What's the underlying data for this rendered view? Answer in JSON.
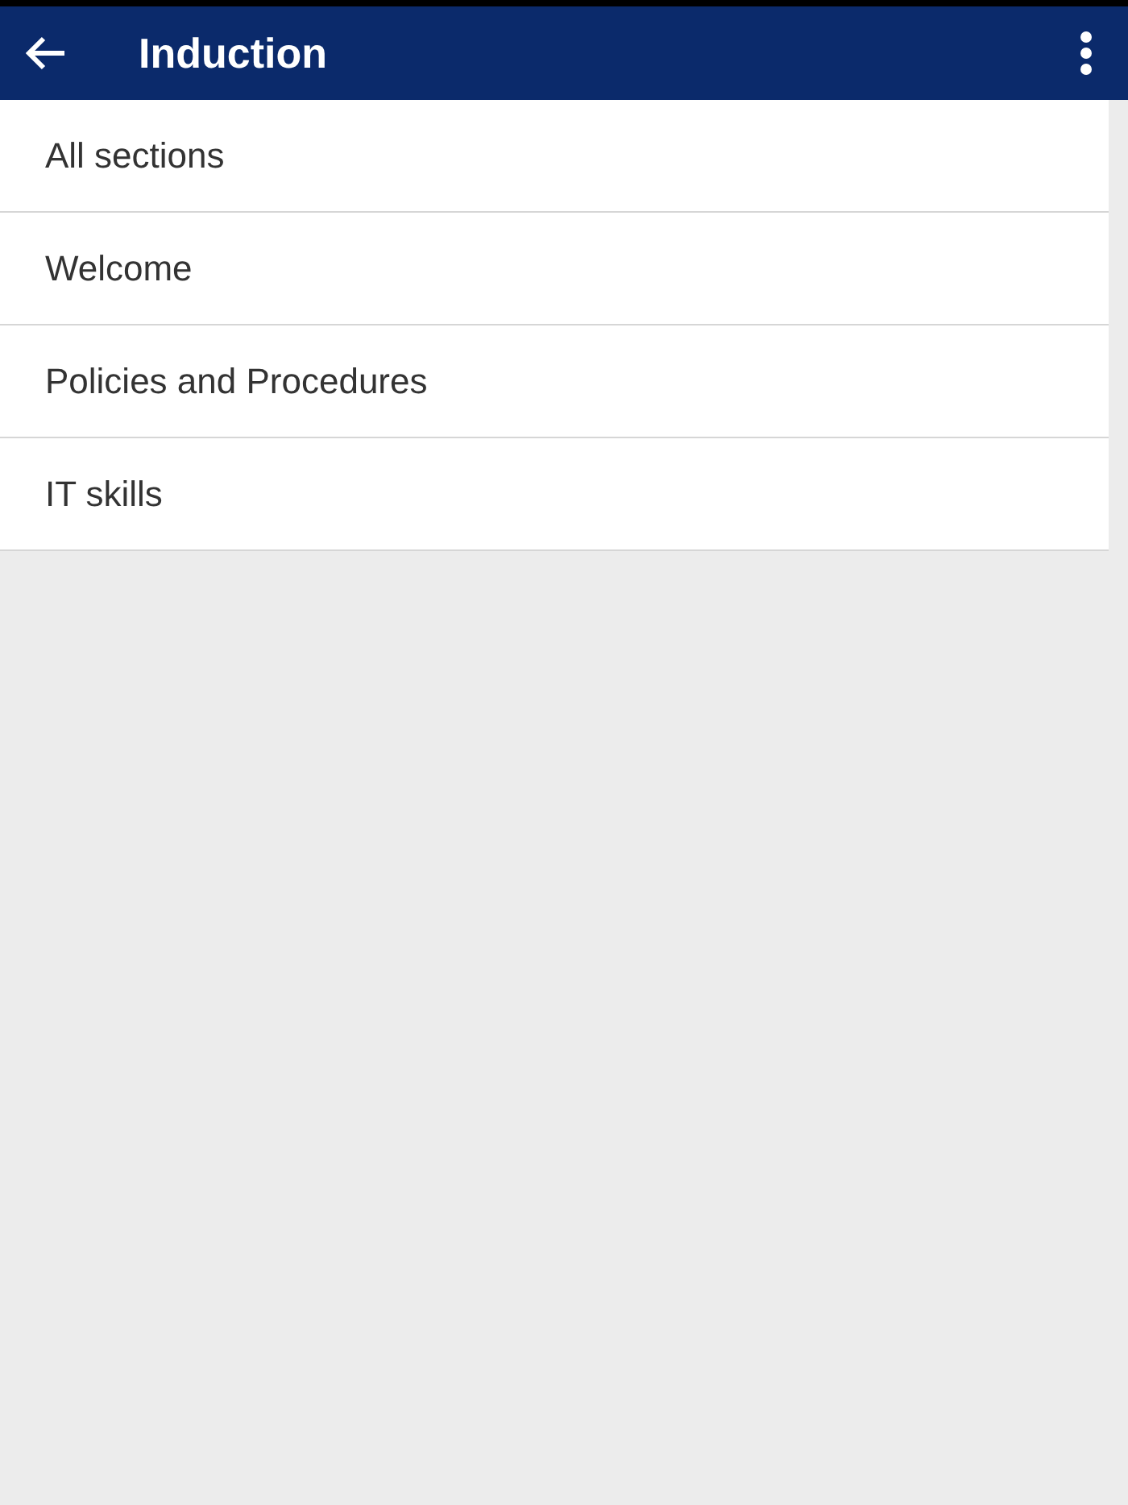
{
  "app_bar": {
    "title": "Induction"
  },
  "sections": [
    {
      "label": "All sections"
    },
    {
      "label": "Welcome"
    },
    {
      "label": "Policies and Procedures"
    },
    {
      "label": "IT skills"
    }
  ]
}
